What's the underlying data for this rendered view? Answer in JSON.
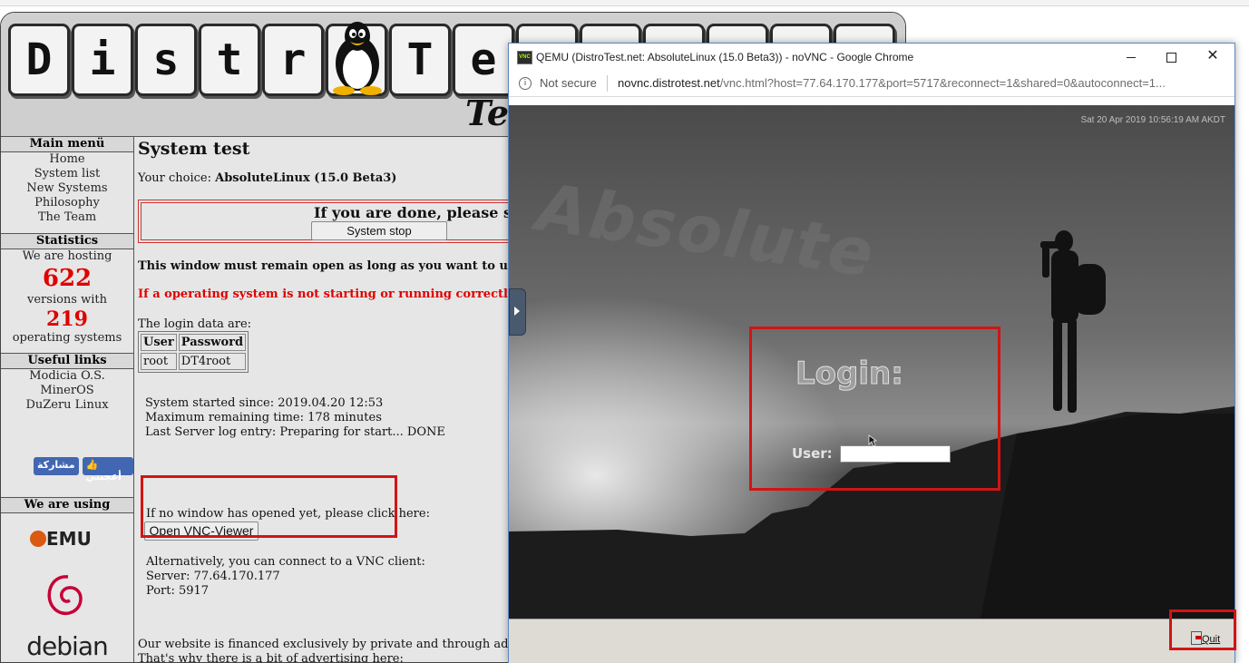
{
  "site": {
    "logo_letters": [
      "D",
      "i",
      "s",
      "t",
      "r",
      "o",
      "T",
      "e"
    ],
    "subtitle": "Tes",
    "sidebar": {
      "main_menu": {
        "title": "Main menü",
        "items": [
          "Home",
          "System list",
          "New Systems",
          "Philosophy",
          "The Team"
        ]
      },
      "statistics": {
        "title": "Statistics",
        "hosting": "We are hosting",
        "versions_count": "622",
        "versions_label": "versions with",
        "os_count": "219",
        "os_label": "operating systems"
      },
      "useful_links": {
        "title": "Useful links",
        "items": [
          "Modicia O.S.",
          "MinerOS",
          "DuZeru Linux"
        ]
      },
      "fb_share": "مشاركة",
      "fb_like": "أعجبني",
      "we_are_using": "We are using",
      "qemu_logo": "EMU",
      "debian_logo": "debian"
    },
    "content": {
      "heading": "System test",
      "choice_label": "Your choice: ",
      "choice_value": "AbsoluteLinux (15.0 Beta3)",
      "stop_text": "If you are done, please stop t",
      "stop_button": "System stop",
      "warning_text": "This window must remain open as long as you want to use the system",
      "red_text": "If a operating system is not starting or running correctly, please writ",
      "login_data_label": "The login data are:",
      "login_table": {
        "headers": [
          "User",
          "Password"
        ],
        "row": [
          "root",
          "DT4root"
        ]
      },
      "system_started": "System started since: 2019.04.20 12:53",
      "max_remaining": "Maximum remaining time: 178 minutes",
      "last_log": "Last Server log entry: Preparing for start... DONE",
      "vnc_prompt": "If no window has opened yet, please click here:",
      "vnc_button": "Open VNC-Viewer",
      "alt_connect": "Alternatively, you can connect to a VNC client:",
      "server": "Server: 77.64.170.177",
      "port": "Port: 5917",
      "finance_1": "Our website is financed exclusively by private and through advertising.",
      "finance_2": "That's why there is a bit of advertising here:"
    }
  },
  "chrome": {
    "title": "QEMU (DistroTest.net: AbsoluteLinux (15.0 Beta3)) - noVNC - Google Chrome",
    "favicon_text": "VNC",
    "not_secure": "Not secure",
    "url_host": "novnc.distrotest.net",
    "url_path": "/vnc.html?host=77.64.170.177&port=5717&reconnect=1&shared=0&autoconnect=1..."
  },
  "vnc": {
    "clock": "Sat 20 Apr 2019 10:56:19 AM AKDT",
    "watermark": "Absolute",
    "login_title": "Login:",
    "user_label": "User:",
    "user_value": "",
    "quit_label": "Quit"
  },
  "colors": {
    "accent_red": "#d21414",
    "stat_red": "#e00000",
    "chrome_border": "#5a86c3",
    "fb_blue": "#4267b2"
  }
}
